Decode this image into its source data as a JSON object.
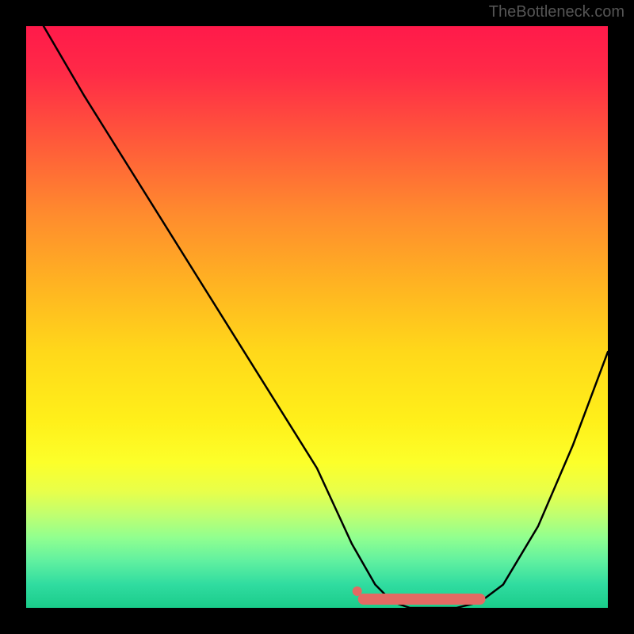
{
  "watermark": "TheBottleneck.com",
  "chart_data": {
    "type": "line",
    "title": "",
    "xlabel": "",
    "ylabel": "",
    "xlim": [
      0,
      100
    ],
    "ylim": [
      0,
      100
    ],
    "series": [
      {
        "name": "bottleneck-curve",
        "x": [
          3,
          10,
          20,
          30,
          40,
          50,
          56,
          60,
          63,
          66,
          70,
          74,
          78,
          82,
          88,
          94,
          100
        ],
        "y": [
          100,
          88,
          72,
          56,
          40,
          24,
          11,
          4,
          1,
          0,
          0,
          0,
          1,
          4,
          14,
          28,
          44
        ]
      }
    ],
    "highlight_band": {
      "name": "optimal-range",
      "x_start": 58,
      "x_end": 78,
      "y": 1.5,
      "color": "#e36a63"
    },
    "gradient_stops": [
      {
        "pos": 0,
        "color": "#ff1a4a"
      },
      {
        "pos": 50,
        "color": "#ffd81a"
      },
      {
        "pos": 100,
        "color": "#1acc8a"
      }
    ]
  }
}
